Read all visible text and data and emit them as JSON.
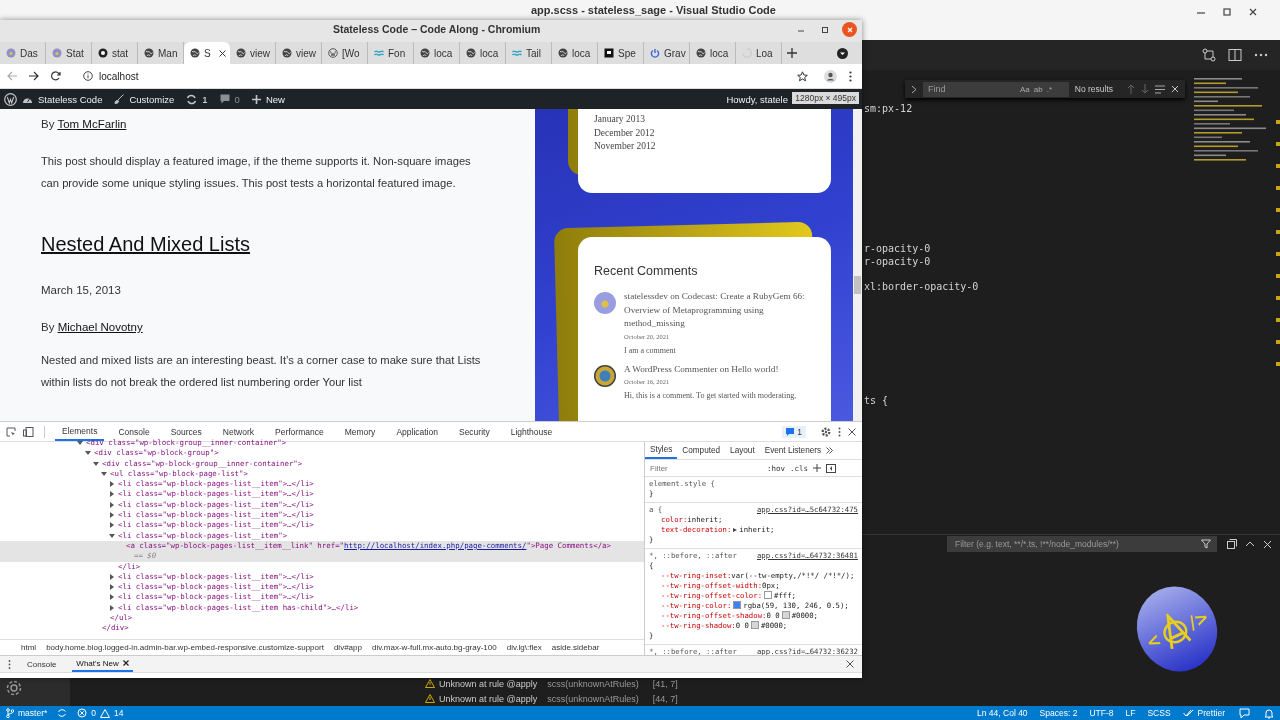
{
  "vscode": {
    "title": "app.scss - stateless_sage - Visual Studio Code",
    "find": {
      "placeholder": "Find",
      "options": [
        "Aa",
        "ab",
        ".*"
      ],
      "status": "No results"
    },
    "code_lines": [
      {
        "text": "sm:px-12"
      },
      {
        "text": "r-opacity-0"
      },
      {
        "text": "r-opacity-0"
      },
      {
        "text": "xl:border-opacity-0"
      },
      {
        "text": "ts {"
      }
    ],
    "panel": {
      "filter_placeholder": "Filter (e.g. text, **/*.ts, !**/node_modules/**)",
      "problems": [
        {
          "message": "Unknown at rule @apply",
          "source": "scss(unknownAtRules)",
          "position": "[41, 7]"
        },
        {
          "message": "Unknown at rule @apply",
          "source": "scss(unknownAtRules)",
          "position": "[44, 7]"
        }
      ]
    },
    "logo": {
      "left": "<",
      "right": "/>"
    },
    "status_bar": {
      "branch": "master*",
      "errors": "0",
      "warnings": "14",
      "cursor": "Ln 44, Col 40",
      "indentation": "Spaces: 2",
      "encoding": "UTF-8",
      "line_ending": "LF",
      "language": "SCSS",
      "formatter": "Prettier"
    }
  },
  "browser": {
    "title": "Stateless Code – Code Along - Chromium",
    "tabs": [
      {
        "label": "Das",
        "kind": "site",
        "selected": false
      },
      {
        "label": "Stat",
        "kind": "site",
        "selected": false
      },
      {
        "label": "stat",
        "kind": "github",
        "selected": false
      },
      {
        "label": "Man",
        "kind": "globe",
        "selected": false
      },
      {
        "label": "S",
        "kind": "globe",
        "selected": true
      },
      {
        "label": "view",
        "kind": "globe",
        "selected": false
      },
      {
        "label": "view",
        "kind": "globe",
        "selected": false
      },
      {
        "label": "[Wo",
        "kind": "wordpress",
        "selected": false
      },
      {
        "label": "Fon",
        "kind": "wave",
        "selected": false
      },
      {
        "label": "loca",
        "kind": "globe",
        "selected": false
      },
      {
        "label": "loca",
        "kind": "globe",
        "selected": false
      },
      {
        "label": "Tail",
        "kind": "wave",
        "selected": false
      },
      {
        "label": "loca",
        "kind": "globe",
        "selected": false
      },
      {
        "label": "Spe",
        "kind": "square",
        "selected": false
      },
      {
        "label": "Grav",
        "kind": "power",
        "selected": false
      },
      {
        "label": "loca",
        "kind": "globe",
        "selected": false
      },
      {
        "label": "Loa",
        "kind": "spinner",
        "selected": false
      }
    ],
    "address": "localhost",
    "admin_bar": {
      "site": "Stateless Code",
      "customize": "Customize",
      "updates": "1",
      "comments": "0",
      "new": "New",
      "greeting": "Howdy, statele"
    },
    "viewport_size": "1280px × 495px",
    "article_tail": {
      "byline_prefix": "By",
      "author": "Tom McFarlin",
      "paragraph": "This post should display a featured image, if the theme supports it. Non-square images can provide some unique styling issues. This post tests a horizontal featured image."
    },
    "article": {
      "title": "Nested And Mixed Lists",
      "date": "March 15, 2013",
      "byline_prefix": "By",
      "author": "Michael Novotny",
      "paragraph": "Nested and mixed lists are an interesting beast. It’s a corner case to make sure that Lists within lists do not break the ordered list numbering order Your list"
    },
    "sidebar": {
      "archives": [
        "January 2013",
        "December 2012",
        "November 2012"
      ],
      "recent_comments": {
        "title": "Recent Comments",
        "items": [
          {
            "text": "statelessdev on Codecast: Create a RubyGem 66: Overview of Metaprogramming using method_missing",
            "date": "October 20, 2021",
            "excerpt": "I am a comment"
          },
          {
            "text": "A WordPress Commenter on Hello world!",
            "date": "October 16, 2021",
            "excerpt": "Hi, this is a comment. To get started with moderating,"
          }
        ]
      }
    },
    "devtools": {
      "tabs": [
        {
          "label": "Elements",
          "selected": true
        },
        {
          "label": "Console",
          "selected": false
        },
        {
          "label": "Sources",
          "selected": false
        },
        {
          "label": "Network",
          "selected": false
        },
        {
          "label": "Performance",
          "selected": false
        },
        {
          "label": "Memory",
          "selected": false
        },
        {
          "label": "Application",
          "selected": false
        },
        {
          "label": "Security",
          "selected": false
        },
        {
          "label": "Lighthouse",
          "selected": false
        }
      ],
      "issues": "1",
      "dom_tree": [
        {
          "text": "<div class=\"wp-block-group__inner-container\">",
          "expanded": true,
          "selected": false,
          "children": [
            {
              "text": "<div class=\"wp-block-group\">",
              "expanded": true,
              "selected": false,
              "children": [
                {
                  "text": "<div class=\"wp-block-group__inner-container\">",
                  "expanded": true,
                  "selected": false,
                  "close": "</div>",
                  "children": [
                    {
                      "text": "<ul class=\"wp-block-page-list\">",
                      "expanded": true,
                      "selected": false,
                      "close": "</ul>",
                      "children": [
                        {
                          "text": "<li class=\"wp-block-pages-list__item\">…</li>",
                          "expanded": false,
                          "selected": false
                        },
                        {
                          "text": "<li class=\"wp-block-pages-list__item\">…</li>",
                          "expanded": false,
                          "selected": false
                        },
                        {
                          "text": "<li class=\"wp-block-pages-list__item\">…</li>",
                          "expanded": false,
                          "selected": false
                        },
                        {
                          "text": "<li class=\"wp-block-pages-list__item\">…</li>",
                          "expanded": false,
                          "selected": false
                        },
                        {
                          "text": "<li class=\"wp-block-pages-list__item\">…</li>",
                          "expanded": false,
                          "selected": false
                        },
                        {
                          "text": "<li class=\"wp-block-pages-list__item\">",
                          "expanded": true,
                          "selected": false,
                          "close": "</li>",
                          "children": [
                            {
                              "text": "<a class=\"wp-block-pages-list__item__link\" href=\"",
                              "link": "http://localhost/index.php/page-comments/",
                              "after": "\">Page Comments</a>",
                              "note": "== $0",
                              "selected": true
                            }
                          ]
                        },
                        {
                          "text": "<li class=\"wp-block-pages-list__item\">…</li>",
                          "expanded": false,
                          "selected": false
                        },
                        {
                          "text": "<li class=\"wp-block-pages-list__item\">…</li>",
                          "expanded": false,
                          "selected": false
                        },
                        {
                          "text": "<li class=\"wp-block-pages-list__item\">…</li>",
                          "expanded": false,
                          "selected": false
                        },
                        {
                          "text": "<li class=\"wp-block-pages-list__item has-child\">…</li>",
                          "expanded": false,
                          "selected": false
                        }
                      ]
                    }
                  ]
                }
              ]
            }
          ]
        }
      ],
      "breadcrumbs": [
        "html",
        "body.home.blog.logged-in.admin-bar.wp-embed-responsive.customize-support",
        "div#app",
        "div.max-w-full.mx-auto.bg-gray-100",
        "div.lg\\:flex",
        "aside.sidebar"
      ],
      "styles_tabs": [
        {
          "label": "Styles",
          "selected": true
        },
        {
          "label": "Computed",
          "selected": false
        },
        {
          "label": "Layout",
          "selected": false
        },
        {
          "label": "Event Listeners",
          "selected": false
        }
      ],
      "styles_filter_placeholder": "Filter",
      "style_buttons": [
        ":hov",
        ".cls"
      ],
      "rules": [
        {
          "selector": "element.style {",
          "close": "}"
        },
        {
          "selector": "a {",
          "source": "app.css?id=…5c64732:475",
          "close": "}",
          "decls": [
            {
              "prop": "color:",
              "value": "inherit;",
              "expandable": false
            },
            {
              "prop": "text-decoration:",
              "value": "inherit;",
              "expandable": true
            }
          ]
        },
        {
          "selector": "*, ::before, ::after",
          "source": "app.css?id=…64732:36481",
          "open": "{",
          "close": "}",
          "decls": [
            {
              "prop": "--tw-ring-inset:",
              "value": "var(--tw-empty,/*!*/ /*!*/);",
              "expandable": false
            },
            {
              "prop": "--tw-ring-offset-width:",
              "value": "0px;",
              "expandable": false
            },
            {
              "prop": "--tw-ring-offset-color:",
              "color": "#ffffff",
              "value": "#fff;",
              "expandable": false
            },
            {
              "prop": "--tw-ring-color:",
              "color": "#3b82f6",
              "value": "rgba(59, 130, 246, 0.5);",
              "expandable": false
            },
            {
              "prop": "--tw-ring-offset-shadow:",
              "prefix": "0 0",
              "color": "#d6d6d6",
              "value": "#0000;",
              "expandable": false
            },
            {
              "prop": "--tw-ring-shadow:",
              "prefix": "0 0",
              "color": "#d6d6d6",
              "value": "#0000;",
              "expandable": false
            }
          ]
        },
        {
          "selector": "*, ::before, ::after",
          "source": "app.css?id=…64732:36232"
        }
      ],
      "drawer_tabs": [
        {
          "label": "Console",
          "selected": false,
          "closable": false
        },
        {
          "label": "What's New",
          "selected": true,
          "closable": true
        }
      ]
    }
  }
}
